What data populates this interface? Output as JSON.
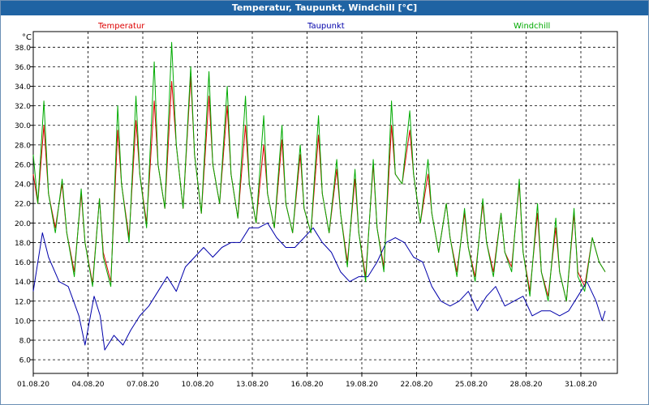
{
  "window": {
    "title": "Temperatur, Taupunkt, Windchill [°C]"
  },
  "chart_data": {
    "type": "line",
    "title": "Temperatur, Taupunkt, Windchill [°C]",
    "ylabel": "°C",
    "xlabel": "",
    "ylim": [
      4.6,
      39.6
    ],
    "xlim": [
      "01.08.20",
      "02.09.20"
    ],
    "grid": true,
    "legend_placement": "top",
    "y_ticks": [
      "6.0",
      "8.0",
      "10.0",
      "12.0",
      "14.0",
      "16.0",
      "18.0",
      "20.0",
      "22.0",
      "24.0",
      "26.0",
      "28.0",
      "30.0",
      "32.0",
      "34.0",
      "36.0",
      "38.0"
    ],
    "x_ticks": [
      "01.08.20",
      "04.08.20",
      "07.08.20",
      "10.08.20",
      "13.08.20",
      "16.08.20",
      "19.08.20",
      "22.08.20",
      "25.08.20",
      "28.08.20",
      "31.08.20"
    ],
    "series": [
      {
        "name": "Temperatur",
        "color": "#dd0000",
        "points": [
          [
            "01.08.20 00:00",
            25.0
          ],
          [
            "01.08.20 06:00",
            22.0
          ],
          [
            "01.08.20 14:00",
            30.0
          ],
          [
            "01.08.20 20:00",
            23.0
          ],
          [
            "02.08.20 05:00",
            19.5
          ],
          [
            "02.08.20 14:00",
            24.0
          ],
          [
            "02.08.20 20:00",
            19.0
          ],
          [
            "03.08.20 06:00",
            15.0
          ],
          [
            "03.08.20 15:00",
            23.0
          ],
          [
            "03.08.20 20:00",
            18.0
          ],
          [
            "04.08.20 06:00",
            13.8
          ],
          [
            "04.08.20 15:00",
            22.5
          ],
          [
            "04.08.20 20:00",
            17.0
          ],
          [
            "05.08.20 06:00",
            14.0
          ],
          [
            "05.08.20 15:00",
            29.5
          ],
          [
            "05.08.20 20:00",
            24.0
          ],
          [
            "06.08.20 06:00",
            18.5
          ],
          [
            "06.08.20 15:00",
            30.5
          ],
          [
            "06.08.20 20:00",
            25.0
          ],
          [
            "07.08.20 05:00",
            20.0
          ],
          [
            "07.08.20 15:00",
            32.5
          ],
          [
            "07.08.20 20:00",
            26.0
          ],
          [
            "08.08.20 05:00",
            21.5
          ],
          [
            "08.08.20 14:00",
            34.5
          ],
          [
            "08.08.20 20:00",
            28.0
          ],
          [
            "09.08.20 05:00",
            21.5
          ],
          [
            "09.08.20 15:00",
            35.0
          ],
          [
            "09.08.20 20:00",
            27.0
          ],
          [
            "10.08.20 05:00",
            21.0
          ],
          [
            "10.08.20 15:00",
            33.0
          ],
          [
            "10.08.20 20:00",
            26.0
          ],
          [
            "11.08.20 05:00",
            22.0
          ],
          [
            "11.08.20 15:00",
            32.0
          ],
          [
            "11.08.20 20:00",
            25.0
          ],
          [
            "12.08.20 05:00",
            20.5
          ],
          [
            "12.08.20 15:00",
            30.0
          ],
          [
            "12.08.20 20:00",
            24.0
          ],
          [
            "13.08.20 05:00",
            20.0
          ],
          [
            "13.08.20 15:00",
            28.0
          ],
          [
            "13.08.20 20:00",
            23.0
          ],
          [
            "14.08.20 05:00",
            19.5
          ],
          [
            "14.08.20 15:00",
            28.5
          ],
          [
            "14.08.20 20:00",
            22.0
          ],
          [
            "15.08.20 05:00",
            19.0
          ],
          [
            "15.08.20 15:00",
            27.0
          ],
          [
            "15.08.20 20:00",
            21.5
          ],
          [
            "16.08.20 05:00",
            19.0
          ],
          [
            "16.08.20 15:00",
            29.0
          ],
          [
            "16.08.20 20:00",
            23.0
          ],
          [
            "17.08.20 05:00",
            19.0
          ],
          [
            "17.08.20 15:00",
            25.5
          ],
          [
            "17.08.20 20:00",
            21.0
          ],
          [
            "18.08.20 05:00",
            16.0
          ],
          [
            "18.08.20 15:00",
            24.5
          ],
          [
            "18.08.20 20:00",
            19.0
          ],
          [
            "19.08.20 05:00",
            14.5
          ],
          [
            "19.08.20 15:00",
            26.0
          ],
          [
            "19.08.20 20:00",
            19.5
          ],
          [
            "20.08.20 05:00",
            15.5
          ],
          [
            "20.08.20 15:00",
            30.0
          ],
          [
            "20.08.20 20:00",
            25.0
          ],
          [
            "21.08.20 05:00",
            24.0
          ],
          [
            "21.08.20 15:00",
            29.5
          ],
          [
            "21.08.20 20:00",
            25.0
          ],
          [
            "22.08.20 05:00",
            20.0
          ],
          [
            "22.08.20 15:00",
            25.0
          ],
          [
            "22.08.20 20:00",
            21.0
          ],
          [
            "23.08.20 05:00",
            17.0
          ],
          [
            "23.08.20 15:00",
            22.0
          ],
          [
            "23.08.20 20:00",
            18.5
          ],
          [
            "24.08.20 05:00",
            15.0
          ],
          [
            "24.08.20 15:00",
            21.0
          ],
          [
            "24.08.20 20:00",
            17.5
          ],
          [
            "25.08.20 05:00",
            14.5
          ],
          [
            "25.08.20 15:00",
            22.0
          ],
          [
            "25.08.20 20:00",
            18.0
          ],
          [
            "26.08.20 05:00",
            15.0
          ],
          [
            "26.08.20 15:00",
            21.0
          ],
          [
            "26.08.20 20:00",
            17.0
          ],
          [
            "27.08.20 05:00",
            15.5
          ],
          [
            "27.08.20 15:00",
            24.0
          ],
          [
            "27.08.20 20:00",
            17.0
          ],
          [
            "28.08.20 05:00",
            13.0
          ],
          [
            "28.08.20 15:00",
            21.0
          ],
          [
            "28.08.20 20:00",
            15.0
          ],
          [
            "29.08.20 05:00",
            12.5
          ],
          [
            "29.08.20 15:00",
            19.5
          ],
          [
            "29.08.20 20:00",
            15.0
          ],
          [
            "30.08.20 05:00",
            12.0
          ],
          [
            "30.08.20 15:00",
            21.0
          ],
          [
            "30.08.20 20:00",
            15.0
          ],
          [
            "31.08.20 05:00",
            13.5
          ],
          [
            "31.08.20 15:00",
            18.5
          ],
          [
            "01.09.20 00:00",
            16.0
          ],
          [
            "01.09.20 08:00",
            15.0
          ]
        ]
      },
      {
        "name": "Taupunkt",
        "color": "#0000aa",
        "points": [
          [
            "01.08.20 00:00",
            13.0
          ],
          [
            "01.08.20 12:00",
            19.0
          ],
          [
            "01.08.20 20:00",
            16.5
          ],
          [
            "02.08.20 10:00",
            14.0
          ],
          [
            "02.08.20 22:00",
            13.5
          ],
          [
            "03.08.20 12:00",
            10.5
          ],
          [
            "03.08.20 20:00",
            7.5
          ],
          [
            "04.08.20 08:00",
            12.5
          ],
          [
            "04.08.20 16:00",
            10.5
          ],
          [
            "04.08.20 22:00",
            7.0
          ],
          [
            "05.08.20 10:00",
            8.5
          ],
          [
            "05.08.20 22:00",
            7.5
          ],
          [
            "06.08.20 08:00",
            9.0
          ],
          [
            "06.08.20 20:00",
            10.5
          ],
          [
            "07.08.20 08:00",
            11.5
          ],
          [
            "07.08.20 20:00",
            13.0
          ],
          [
            "08.08.20 08:00",
            14.5
          ],
          [
            "08.08.20 20:00",
            13.0
          ],
          [
            "09.08.20 08:00",
            15.5
          ],
          [
            "09.08.20 20:00",
            16.5
          ],
          [
            "10.08.20 08:00",
            17.5
          ],
          [
            "10.08.20 20:00",
            16.5
          ],
          [
            "11.08.20 08:00",
            17.5
          ],
          [
            "11.08.20 20:00",
            18.0
          ],
          [
            "12.08.20 08:00",
            18.0
          ],
          [
            "12.08.20 20:00",
            19.5
          ],
          [
            "13.08.20 08:00",
            19.5
          ],
          [
            "13.08.20 20:00",
            20.0
          ],
          [
            "14.08.20 08:00",
            18.5
          ],
          [
            "14.08.20 20:00",
            17.5
          ],
          [
            "15.08.20 08:00",
            17.5
          ],
          [
            "15.08.20 20:00",
            18.5
          ],
          [
            "16.08.20 08:00",
            19.5
          ],
          [
            "16.08.20 20:00",
            18.0
          ],
          [
            "17.08.20 08:00",
            17.0
          ],
          [
            "17.08.20 20:00",
            15.0
          ],
          [
            "18.08.20 08:00",
            14.0
          ],
          [
            "18.08.20 20:00",
            14.5
          ],
          [
            "19.08.20 08:00",
            14.5
          ],
          [
            "19.08.20 20:00",
            16.0
          ],
          [
            "20.08.20 08:00",
            18.0
          ],
          [
            "20.08.20 20:00",
            18.5
          ],
          [
            "21.08.20 08:00",
            18.0
          ],
          [
            "21.08.20 20:00",
            16.5
          ],
          [
            "22.08.20 08:00",
            16.0
          ],
          [
            "22.08.20 20:00",
            13.5
          ],
          [
            "23.08.20 08:00",
            12.0
          ],
          [
            "23.08.20 20:00",
            11.5
          ],
          [
            "24.08.20 08:00",
            12.0
          ],
          [
            "24.08.20 20:00",
            13.0
          ],
          [
            "25.08.20 08:00",
            11.0
          ],
          [
            "25.08.20 20:00",
            12.5
          ],
          [
            "26.08.20 08:00",
            13.5
          ],
          [
            "26.08.20 20:00",
            11.5
          ],
          [
            "27.08.20 08:00",
            12.0
          ],
          [
            "27.08.20 20:00",
            12.5
          ],
          [
            "28.08.20 08:00",
            10.5
          ],
          [
            "28.08.20 20:00",
            11.0
          ],
          [
            "29.08.20 08:00",
            11.0
          ],
          [
            "29.08.20 20:00",
            10.5
          ],
          [
            "30.08.20 08:00",
            11.0
          ],
          [
            "30.08.20 20:00",
            12.5
          ],
          [
            "31.08.20 08:00",
            14.0
          ],
          [
            "31.08.20 20:00",
            12.0
          ],
          [
            "01.09.20 04:00",
            10.0
          ],
          [
            "01.09.20 08:00",
            11.0
          ]
        ]
      },
      {
        "name": "Windchill",
        "color": "#00aa00",
        "points": [
          [
            "01.08.20 00:00",
            27.0
          ],
          [
            "01.08.20 06:00",
            22.0
          ],
          [
            "01.08.20 14:00",
            32.5
          ],
          [
            "01.08.20 20:00",
            23.0
          ],
          [
            "02.08.20 05:00",
            19.0
          ],
          [
            "02.08.20 14:00",
            24.5
          ],
          [
            "02.08.20 20:00",
            19.0
          ],
          [
            "03.08.20 06:00",
            14.5
          ],
          [
            "03.08.20 15:00",
            23.5
          ],
          [
            "03.08.20 20:00",
            18.0
          ],
          [
            "04.08.20 06:00",
            13.5
          ],
          [
            "04.08.20 15:00",
            22.5
          ],
          [
            "04.08.20 20:00",
            16.5
          ],
          [
            "05.08.20 06:00",
            13.5
          ],
          [
            "05.08.20 15:00",
            32.0
          ],
          [
            "05.08.20 20:00",
            24.0
          ],
          [
            "06.08.20 06:00",
            18.0
          ],
          [
            "06.08.20 15:00",
            33.0
          ],
          [
            "06.08.20 20:00",
            25.0
          ],
          [
            "07.08.20 05:00",
            19.5
          ],
          [
            "07.08.20 15:00",
            36.5
          ],
          [
            "07.08.20 20:00",
            26.0
          ],
          [
            "08.08.20 05:00",
            21.5
          ],
          [
            "08.08.20 14:00",
            38.5
          ],
          [
            "08.08.20 20:00",
            28.0
          ],
          [
            "09.08.20 05:00",
            21.5
          ],
          [
            "09.08.20 15:00",
            36.0
          ],
          [
            "09.08.20 20:00",
            27.0
          ],
          [
            "10.08.20 05:00",
            21.0
          ],
          [
            "10.08.20 15:00",
            35.5
          ],
          [
            "10.08.20 20:00",
            26.0
          ],
          [
            "11.08.20 05:00",
            22.0
          ],
          [
            "11.08.20 15:00",
            34.0
          ],
          [
            "11.08.20 20:00",
            25.0
          ],
          [
            "12.08.20 05:00",
            20.5
          ],
          [
            "12.08.20 15:00",
            33.0
          ],
          [
            "12.08.20 20:00",
            24.0
          ],
          [
            "13.08.20 05:00",
            20.0
          ],
          [
            "13.08.20 15:00",
            31.0
          ],
          [
            "13.08.20 20:00",
            23.0
          ],
          [
            "14.08.20 05:00",
            19.5
          ],
          [
            "14.08.20 15:00",
            30.0
          ],
          [
            "14.08.20 20:00",
            22.0
          ],
          [
            "15.08.20 05:00",
            19.0
          ],
          [
            "15.08.20 15:00",
            28.0
          ],
          [
            "15.08.20 20:00",
            21.5
          ],
          [
            "16.08.20 05:00",
            19.0
          ],
          [
            "16.08.20 15:00",
            31.0
          ],
          [
            "16.08.20 20:00",
            23.0
          ],
          [
            "17.08.20 05:00",
            19.0
          ],
          [
            "17.08.20 15:00",
            26.5
          ],
          [
            "17.08.20 20:00",
            21.0
          ],
          [
            "18.08.20 05:00",
            15.5
          ],
          [
            "18.08.20 15:00",
            25.5
          ],
          [
            "18.08.20 20:00",
            19.0
          ],
          [
            "19.08.20 05:00",
            14.0
          ],
          [
            "19.08.20 15:00",
            26.5
          ],
          [
            "19.08.20 20:00",
            19.5
          ],
          [
            "20.08.20 05:00",
            15.0
          ],
          [
            "20.08.20 15:00",
            32.5
          ],
          [
            "20.08.20 20:00",
            25.0
          ],
          [
            "21.08.20 05:00",
            24.0
          ],
          [
            "21.08.20 15:00",
            31.5
          ],
          [
            "21.08.20 20:00",
            25.0
          ],
          [
            "22.08.20 05:00",
            20.0
          ],
          [
            "22.08.20 15:00",
            26.5
          ],
          [
            "22.08.20 20:00",
            21.0
          ],
          [
            "23.08.20 05:00",
            17.0
          ],
          [
            "23.08.20 15:00",
            22.0
          ],
          [
            "23.08.20 20:00",
            18.5
          ],
          [
            "24.08.20 05:00",
            14.5
          ],
          [
            "24.08.20 15:00",
            21.5
          ],
          [
            "24.08.20 20:00",
            17.5
          ],
          [
            "25.08.20 05:00",
            14.0
          ],
          [
            "25.08.20 15:00",
            22.5
          ],
          [
            "25.08.20 20:00",
            18.0
          ],
          [
            "26.08.20 05:00",
            14.5
          ],
          [
            "26.08.20 15:00",
            21.0
          ],
          [
            "26.08.20 20:00",
            17.0
          ],
          [
            "27.08.20 05:00",
            15.0
          ],
          [
            "27.08.20 15:00",
            24.5
          ],
          [
            "27.08.20 20:00",
            17.0
          ],
          [
            "28.08.20 05:00",
            12.5
          ],
          [
            "28.08.20 15:00",
            22.0
          ],
          [
            "28.08.20 20:00",
            15.0
          ],
          [
            "29.08.20 05:00",
            12.0
          ],
          [
            "29.08.20 15:00",
            20.5
          ],
          [
            "29.08.20 20:00",
            15.0
          ],
          [
            "30.08.20 05:00",
            12.0
          ],
          [
            "30.08.20 15:00",
            21.5
          ],
          [
            "30.08.20 20:00",
            14.5
          ],
          [
            "31.08.20 05:00",
            13.0
          ],
          [
            "31.08.20 15:00",
            18.5
          ],
          [
            "01.09.20 00:00",
            16.0
          ],
          [
            "01.09.20 08:00",
            15.0
          ]
        ]
      }
    ]
  }
}
